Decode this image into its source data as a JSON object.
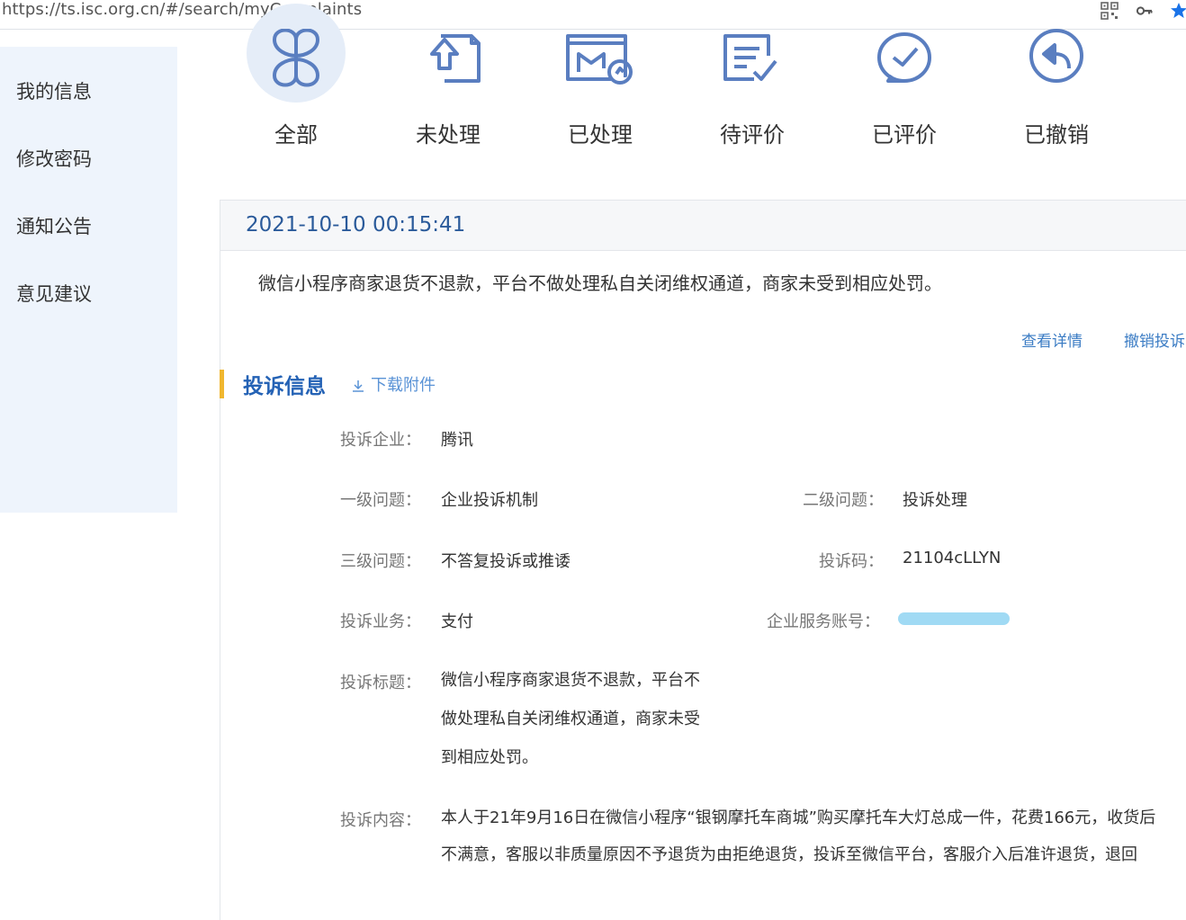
{
  "browser": {
    "url": "https://ts.isc.org.cn/#/search/myComplaints",
    "icons": [
      "qr-code-icon",
      "key-icon",
      "star-icon"
    ]
  },
  "sidebar": {
    "items": [
      {
        "label": "我的信息"
      },
      {
        "label": "修改密码"
      },
      {
        "label": "通知公告"
      },
      {
        "label": "意见建议"
      }
    ]
  },
  "tabs": [
    {
      "label": "全部",
      "icon": "grid-icon",
      "active": true
    },
    {
      "label": "未处理",
      "icon": "upload-doc-icon"
    },
    {
      "label": "已处理",
      "icon": "processed-doc-icon"
    },
    {
      "label": "待评价",
      "icon": "pending-review-icon"
    },
    {
      "label": "已评价",
      "icon": "check-chat-icon"
    },
    {
      "label": "已撤销",
      "icon": "undo-icon"
    }
  ],
  "complaint": {
    "time": "2021-10-10 00:15:41",
    "summary": "微信小程序商家退货不退款，平台不做处理私自关闭维权通道，商家未受到相应处罚。",
    "view_details": "查看详情",
    "withdraw": "撤销投诉"
  },
  "info": {
    "section_title": "投诉信息",
    "download": "下载附件",
    "company_label": "投诉企业：",
    "company": "腾讯",
    "level1_label": "一级问题：",
    "level1": "企业投诉机制",
    "level2_label": "二级问题：",
    "level2": "投诉处理",
    "level3_label": "三级问题：",
    "level3": "不答复投诉或推诿",
    "code_label": "投诉码：",
    "code": "21104cLLYN",
    "business_label": "投诉业务：",
    "business": "支付",
    "account_label": "企业服务账号：",
    "title_label": "投诉标题：",
    "title_lines": [
      "微信小程序商家退货不退款，平台不",
      "做处理私自关闭维权通道，商家未受",
      "到相应处罚。"
    ],
    "content_label": "投诉内容：",
    "content_lines": [
      "本人于21年9月16日在微信小程序“银钢摩托车商城”购买摩托车大灯总成一件，花费166元，收货后",
      "不满意，客服以非质量原因不予退货为由拒绝退货，投诉至微信平台，客服介入后准许退货，退回"
    ]
  }
}
